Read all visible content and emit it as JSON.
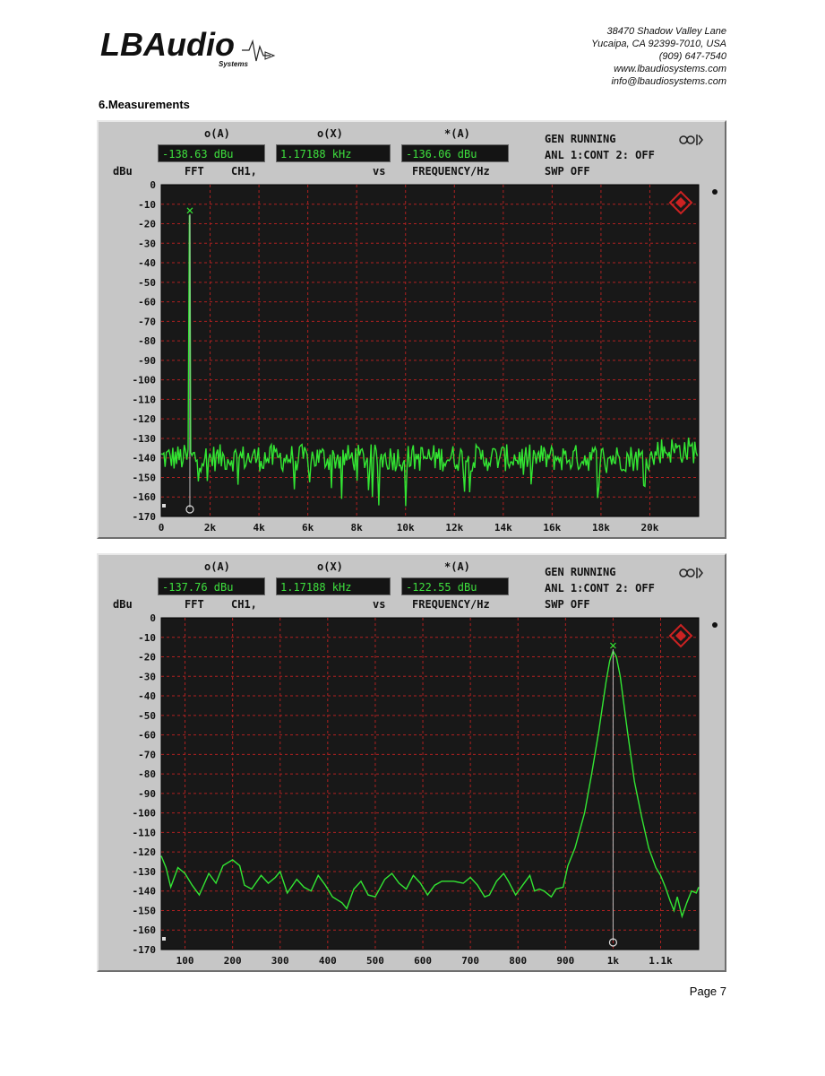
{
  "header": {
    "logo_text": "LBAudio",
    "logo_subtext": "Systems",
    "address_lines": [
      "38470 Shadow Valley Lane",
      "Yucaipa, CA 92399-7010, USA",
      "(909) 647-7540",
      "www.lbaudiosystems.com",
      "info@lbaudiosystems.com"
    ]
  },
  "section_title": "6.Measurements",
  "page_label": "Page 7",
  "colors": {
    "trace": "#33e633",
    "grid": "#b02020",
    "screen_bg": "#181818",
    "bezel": "#c6c6c6"
  },
  "analyzers": [
    {
      "headers": {
        "o_a": "o(A)",
        "o_x": "o(X)",
        "star_a": "*(A)"
      },
      "readouts": {
        "o_a": "-138.63 dBu",
        "o_x": "1.17188 kHz",
        "star_a": "-136.06 dBu"
      },
      "axis_unit": "dBu",
      "sub_labels": {
        "fft": "FFT",
        "ch": "CH1,",
        "vs": "vs",
        "freq": "FREQUENCY/Hz"
      },
      "status": {
        "line1": "GEN RUNNING",
        "line2": "ANL 1:CONT 2: OFF",
        "line3": "SWP OFF"
      }
    },
    {
      "headers": {
        "o_a": "o(A)",
        "o_x": "o(X)",
        "star_a": "*(A)"
      },
      "readouts": {
        "o_a": "-137.76 dBu",
        "o_x": "1.17188 kHz",
        "star_a": "-122.55 dBu"
      },
      "axis_unit": "dBu",
      "sub_labels": {
        "fft": "FFT",
        "ch": "CH1,",
        "vs": "vs",
        "freq": "FREQUENCY/Hz"
      },
      "status": {
        "line1": "GEN RUNNING",
        "line2": "ANL 1:CONT 2: OFF",
        "line3": "SWP OFF"
      }
    }
  ],
  "chart_data": [
    {
      "type": "line",
      "xlim": [
        0,
        22000
      ],
      "ylim": [
        -170,
        0
      ],
      "y_ticks": [
        0,
        -10,
        -20,
        -30,
        -40,
        -50,
        -60,
        -70,
        -80,
        -90,
        -100,
        -110,
        -120,
        -130,
        -140,
        -150,
        -160,
        -170
      ],
      "x_ticks": [
        {
          "v": 0,
          "label": "0"
        },
        {
          "v": 2000,
          "label": "2k"
        },
        {
          "v": 4000,
          "label": "4k"
        },
        {
          "v": 6000,
          "label": "6k"
        },
        {
          "v": 8000,
          "label": "8k"
        },
        {
          "v": 10000,
          "label": "10k"
        },
        {
          "v": 12000,
          "label": "12k"
        },
        {
          "v": 14000,
          "label": "14k"
        },
        {
          "v": 16000,
          "label": "16k"
        },
        {
          "v": 18000,
          "label": "18k"
        },
        {
          "v": 20000,
          "label": "20k"
        }
      ],
      "peak": {
        "x": 1171.88,
        "y": -16
      },
      "noise_floor": -140,
      "series": [
        {
          "values": "FFT noise floor about -140 dBu with a single peak at 1.17188 kHz"
        }
      ],
      "grid": true
    },
    {
      "type": "line",
      "xlim": [
        50,
        1180
      ],
      "ylim": [
        -170,
        0
      ],
      "y_ticks": [
        0,
        -10,
        -20,
        -30,
        -40,
        -50,
        -60,
        -70,
        -80,
        -90,
        -100,
        -110,
        -120,
        -130,
        -140,
        -150,
        -160,
        -170
      ],
      "x_ticks": [
        {
          "v": 100,
          "label": "100"
        },
        {
          "v": 200,
          "label": "200"
        },
        {
          "v": 300,
          "label": "300"
        },
        {
          "v": 400,
          "label": "400"
        },
        {
          "v": 500,
          "label": "500"
        },
        {
          "v": 600,
          "label": "600"
        },
        {
          "v": 700,
          "label": "700"
        },
        {
          "v": 800,
          "label": "800"
        },
        {
          "v": 900,
          "label": "900"
        },
        {
          "v": 1000,
          "label": "1k"
        },
        {
          "v": 1100,
          "label": "1.1k"
        }
      ],
      "points": [
        [
          50,
          -122
        ],
        [
          60,
          -128
        ],
        [
          70,
          -138
        ],
        [
          85,
          -128
        ],
        [
          100,
          -131
        ],
        [
          115,
          -137
        ],
        [
          130,
          -142
        ],
        [
          150,
          -131
        ],
        [
          165,
          -136
        ],
        [
          180,
          -127
        ],
        [
          200,
          -124
        ],
        [
          215,
          -127
        ],
        [
          225,
          -137
        ],
        [
          240,
          -139
        ],
        [
          260,
          -132
        ],
        [
          275,
          -136
        ],
        [
          290,
          -133
        ],
        [
          300,
          -130
        ],
        [
          315,
          -141
        ],
        [
          335,
          -134
        ],
        [
          350,
          -138
        ],
        [
          365,
          -140
        ],
        [
          380,
          -132
        ],
        [
          395,
          -137
        ],
        [
          410,
          -143
        ],
        [
          430,
          -146
        ],
        [
          440,
          -149
        ],
        [
          455,
          -139
        ],
        [
          470,
          -135
        ],
        [
          485,
          -142
        ],
        [
          500,
          -143
        ],
        [
          520,
          -134
        ],
        [
          535,
          -131
        ],
        [
          550,
          -136
        ],
        [
          565,
          -139
        ],
        [
          580,
          -132
        ],
        [
          595,
          -136
        ],
        [
          610,
          -142
        ],
        [
          625,
          -137
        ],
        [
          640,
          -135
        ],
        [
          665,
          -135
        ],
        [
          685,
          -136
        ],
        [
          700,
          -133
        ],
        [
          715,
          -137
        ],
        [
          730,
          -143
        ],
        [
          740,
          -142
        ],
        [
          755,
          -135
        ],
        [
          770,
          -131
        ],
        [
          780,
          -135
        ],
        [
          795,
          -142
        ],
        [
          810,
          -137
        ],
        [
          825,
          -132
        ],
        [
          835,
          -140
        ],
        [
          845,
          -139
        ],
        [
          855,
          -140
        ],
        [
          870,
          -143
        ],
        [
          880,
          -139
        ],
        [
          895,
          -138
        ],
        [
          905,
          -127
        ],
        [
          920,
          -118
        ],
        [
          940,
          -100
        ],
        [
          955,
          -80
        ],
        [
          970,
          -58
        ],
        [
          985,
          -33
        ],
        [
          993,
          -22
        ],
        [
          1000,
          -17
        ],
        [
          1007,
          -20
        ],
        [
          1015,
          -30
        ],
        [
          1030,
          -58
        ],
        [
          1045,
          -84
        ],
        [
          1060,
          -102
        ],
        [
          1075,
          -118
        ],
        [
          1090,
          -128
        ],
        [
          1100,
          -132
        ],
        [
          1110,
          -138
        ],
        [
          1120,
          -145
        ],
        [
          1128,
          -150
        ],
        [
          1135,
          -143
        ],
        [
          1145,
          -153
        ],
        [
          1155,
          -146
        ],
        [
          1165,
          -140
        ],
        [
          1175,
          -141
        ],
        [
          1180,
          -138
        ]
      ],
      "peak": {
        "x": 1000,
        "y": -17
      },
      "grid": true
    }
  ]
}
